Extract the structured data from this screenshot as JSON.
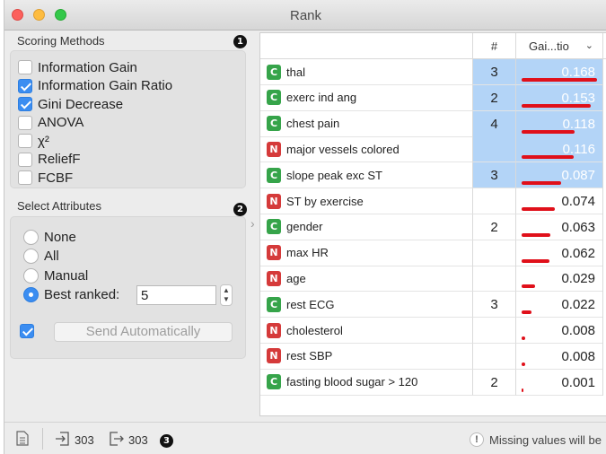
{
  "window": {
    "title": "Rank"
  },
  "scoring": {
    "title": "Scoring Methods",
    "badge": "1",
    "methods": [
      {
        "label": "Information Gain",
        "checked": false
      },
      {
        "label": "Information Gain Ratio",
        "checked": true
      },
      {
        "label": "Gini Decrease",
        "checked": true
      },
      {
        "label": "ANOVA",
        "checked": false
      },
      {
        "label": "χ²",
        "checked": false
      },
      {
        "label": "ReliefF",
        "checked": false
      },
      {
        "label": "FCBF",
        "checked": false
      }
    ]
  },
  "select": {
    "title": "Select Attributes",
    "badge": "2",
    "options": [
      {
        "label": "None",
        "checked": false
      },
      {
        "label": "All",
        "checked": false
      },
      {
        "label": "Manual",
        "checked": false
      },
      {
        "label": "Best ranked:",
        "checked": true
      }
    ],
    "best_ranked_value": "5"
  },
  "send": {
    "label": "Send Automatically",
    "checked": true
  },
  "table": {
    "headers": {
      "num": "#",
      "score": "Gai...tio",
      "score_max": 0.168
    },
    "rows": [
      {
        "type": "C",
        "name": "thal",
        "num": "3",
        "score": "0.168",
        "value": 0.168,
        "selected": true
      },
      {
        "type": "C",
        "name": "exerc ind ang",
        "num": "2",
        "score": "0.153",
        "value": 0.153,
        "selected": true
      },
      {
        "type": "C",
        "name": "chest pain",
        "num": "4",
        "score": "0.118",
        "value": 0.118,
        "selected": true
      },
      {
        "type": "N",
        "name": "major vessels colored",
        "num": "",
        "score": "0.116",
        "value": 0.116,
        "selected": true
      },
      {
        "type": "C",
        "name": "slope peak exc ST",
        "num": "3",
        "score": "0.087",
        "value": 0.087,
        "selected": true
      },
      {
        "type": "N",
        "name": "ST by exercise",
        "num": "",
        "score": "0.074",
        "value": 0.074,
        "selected": false
      },
      {
        "type": "C",
        "name": "gender",
        "num": "2",
        "score": "0.063",
        "value": 0.063,
        "selected": false
      },
      {
        "type": "N",
        "name": "max HR",
        "num": "",
        "score": "0.062",
        "value": 0.062,
        "selected": false
      },
      {
        "type": "N",
        "name": "age",
        "num": "",
        "score": "0.029",
        "value": 0.029,
        "selected": false
      },
      {
        "type": "C",
        "name": "rest ECG",
        "num": "3",
        "score": "0.022",
        "value": 0.022,
        "selected": false
      },
      {
        "type": "N",
        "name": "cholesterol",
        "num": "",
        "score": "0.008",
        "value": 0.008,
        "selected": false
      },
      {
        "type": "N",
        "name": "rest SBP",
        "num": "",
        "score": "0.008",
        "value": 0.008,
        "selected": false
      },
      {
        "type": "C",
        "name": "fasting blood sugar > 120",
        "num": "2",
        "score": "0.001",
        "value": 0.001,
        "selected": false
      }
    ]
  },
  "status": {
    "input_count": "303",
    "output_count": "303",
    "badge": "3",
    "warning": "Missing values will be"
  },
  "colors": {
    "accent": "#3b8df1",
    "selection": "#b3d4f7",
    "bar": "#e0101a",
    "continuous": "#36a44a",
    "discrete": "#d53a3a"
  }
}
